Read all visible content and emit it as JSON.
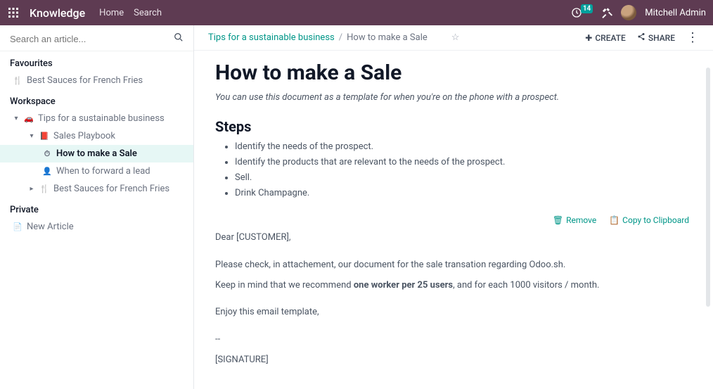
{
  "nav": {
    "brand": "Knowledge",
    "links": [
      "Home",
      "Search"
    ],
    "activity_count": "14",
    "user_name": "Mitchell Admin"
  },
  "sidebar": {
    "search_placeholder": "Search an article...",
    "sections": {
      "favourites": {
        "title": "Favourites",
        "items": [
          {
            "label": "Best Sauces for French Fries",
            "icon": "cutlery"
          }
        ]
      },
      "workspace": {
        "title": "Workspace",
        "tree": {
          "label": "Tips for a sustainable business",
          "icon": "car",
          "children": [
            {
              "label": "Sales Playbook",
              "icon": "book",
              "children": [
                {
                  "label": "How to make a Sale",
                  "icon": "clock",
                  "active": true
                },
                {
                  "label": "When to forward a lead",
                  "icon": "person"
                }
              ]
            },
            {
              "label": "Best Sauces for French Fries",
              "icon": "cutlery"
            }
          ]
        }
      },
      "private": {
        "title": "Private",
        "items": [
          {
            "label": "New Article",
            "icon": "doc"
          }
        ]
      }
    }
  },
  "breadcrumb": {
    "parent": "Tips for a sustainable business",
    "current": "How to make a Sale"
  },
  "actions": {
    "create": "CREATE",
    "share": "SHARE"
  },
  "article": {
    "title": "How to make a Sale",
    "subtitle": "You can use this document as a template for when you're on the phone with a prospect.",
    "steps_heading": "Steps",
    "steps": [
      "Identify the needs of the prospect.",
      "Identify the products that are relevant to the needs of the prospect.",
      "Sell.",
      "Drink Champagne."
    ],
    "template_actions": {
      "remove": "Remove",
      "copy": "Copy to Clipboard"
    },
    "email": {
      "greeting": "Dear [CUSTOMER],",
      "line1_a": "Please check, in attachement, our document for the sale transation regarding Odoo.sh.",
      "line2_a": "Keep in mind that we recommend ",
      "line2_bold": "one worker per 25 users",
      "line2_b": ", and for each 1000 visitors / month.",
      "enjoy": "Enjoy this email template,",
      "dashes": "--",
      "signature": "[SIGNATURE]"
    }
  }
}
